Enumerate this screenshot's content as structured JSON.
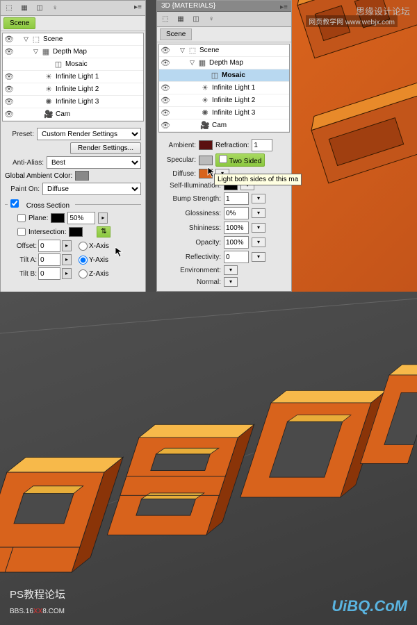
{
  "panel1": {
    "tab": "Scene",
    "scene": {
      "items": [
        {
          "label": "Scene",
          "indent": 0,
          "icon": "scene",
          "eye": true,
          "tri": "▽",
          "sel": false
        },
        {
          "label": "Depth Map",
          "indent": 1,
          "icon": "mesh",
          "eye": true,
          "tri": "▽",
          "sel": false
        },
        {
          "label": "Mosaic",
          "indent": 2,
          "icon": "mat",
          "eye": false,
          "tri": "",
          "sel": false
        },
        {
          "label": "Infinite Light 1",
          "indent": 1,
          "icon": "light",
          "eye": true,
          "tri": "",
          "sel": false
        },
        {
          "label": "Infinite Light 2",
          "indent": 1,
          "icon": "light",
          "eye": true,
          "tri": "",
          "sel": false
        },
        {
          "label": "Infinite Light 3",
          "indent": 1,
          "icon": "light",
          "eye": true,
          "tri": "",
          "sel": false
        },
        {
          "label": "Cam",
          "indent": 1,
          "icon": "cam",
          "eye": true,
          "tri": "",
          "sel": false
        }
      ]
    },
    "preset_label": "Preset:",
    "preset_value": "Custom Render Settings",
    "render_btn": "Render Settings...",
    "antialias_label": "Anti-Alias:",
    "antialias_value": "Best",
    "gac_label": "Global Ambient Color:",
    "painton_label": "Paint On:",
    "painton_value": "Diffuse",
    "cross_label": "Cross Section",
    "plane_label": "Plane:",
    "plane_value": "50%",
    "intersection_label": "Intersection:",
    "offset_label": "Offset:",
    "offset_value": "0",
    "tilta_label": "Tilt A:",
    "tilta_value": "0",
    "tiltb_label": "Tilt B:",
    "tiltb_value": "0",
    "xaxis": "X-Axis",
    "yaxis": "Y-Axis",
    "zaxis": "Z-Axis"
  },
  "panel2": {
    "header": "3D {MATERIALS}",
    "tab": "Scene",
    "scene": {
      "items": [
        {
          "label": "Scene",
          "indent": 0,
          "icon": "scene",
          "eye": true,
          "tri": "▽",
          "sel": false
        },
        {
          "label": "Depth Map",
          "indent": 1,
          "icon": "mesh",
          "eye": true,
          "tri": "▽",
          "sel": false
        },
        {
          "label": "Mosaic",
          "indent": 2,
          "icon": "mat",
          "eye": false,
          "tri": "",
          "sel": true
        },
        {
          "label": "Infinite Light 1",
          "indent": 1,
          "icon": "light",
          "eye": true,
          "tri": "",
          "sel": false
        },
        {
          "label": "Infinite Light 2",
          "indent": 1,
          "icon": "light",
          "eye": true,
          "tri": "",
          "sel": false
        },
        {
          "label": "Infinite Light 3",
          "indent": 1,
          "icon": "light",
          "eye": true,
          "tri": "",
          "sel": false
        },
        {
          "label": "Cam",
          "indent": 1,
          "icon": "cam",
          "eye": true,
          "tri": "",
          "sel": false
        }
      ]
    },
    "ambient_label": "Ambient:",
    "refraction_label": "Refraction:",
    "refraction_value": "1",
    "specular_label": "Specular:",
    "twosided_label": "Two Sided",
    "tooltip": "Light both sides of this ma",
    "diffuse_label": "Diffuse:",
    "selfillum_label": "Self-Illumination:",
    "bump_label": "Bump Strength:",
    "bump_value": "1",
    "gloss_label": "Glossiness:",
    "gloss_value": "0%",
    "shine_label": "Shininess:",
    "shine_value": "100%",
    "opacity_label": "Opacity:",
    "opacity_value": "100%",
    "reflect_label": "Reflectivity:",
    "reflect_value": "0",
    "env_label": "Environment:",
    "normal_label": "Normal:"
  },
  "watermarks": {
    "top_right": "思缘设计论坛",
    "top_url": "网页教学网 www.webjx.com",
    "bottom_left1": "PS教程论坛",
    "bottom_left2": "BBS.16",
    "bottom_left3": "XX",
    "bottom_left4": "8.COM",
    "bottom_right": "UiBQ.CoM"
  }
}
